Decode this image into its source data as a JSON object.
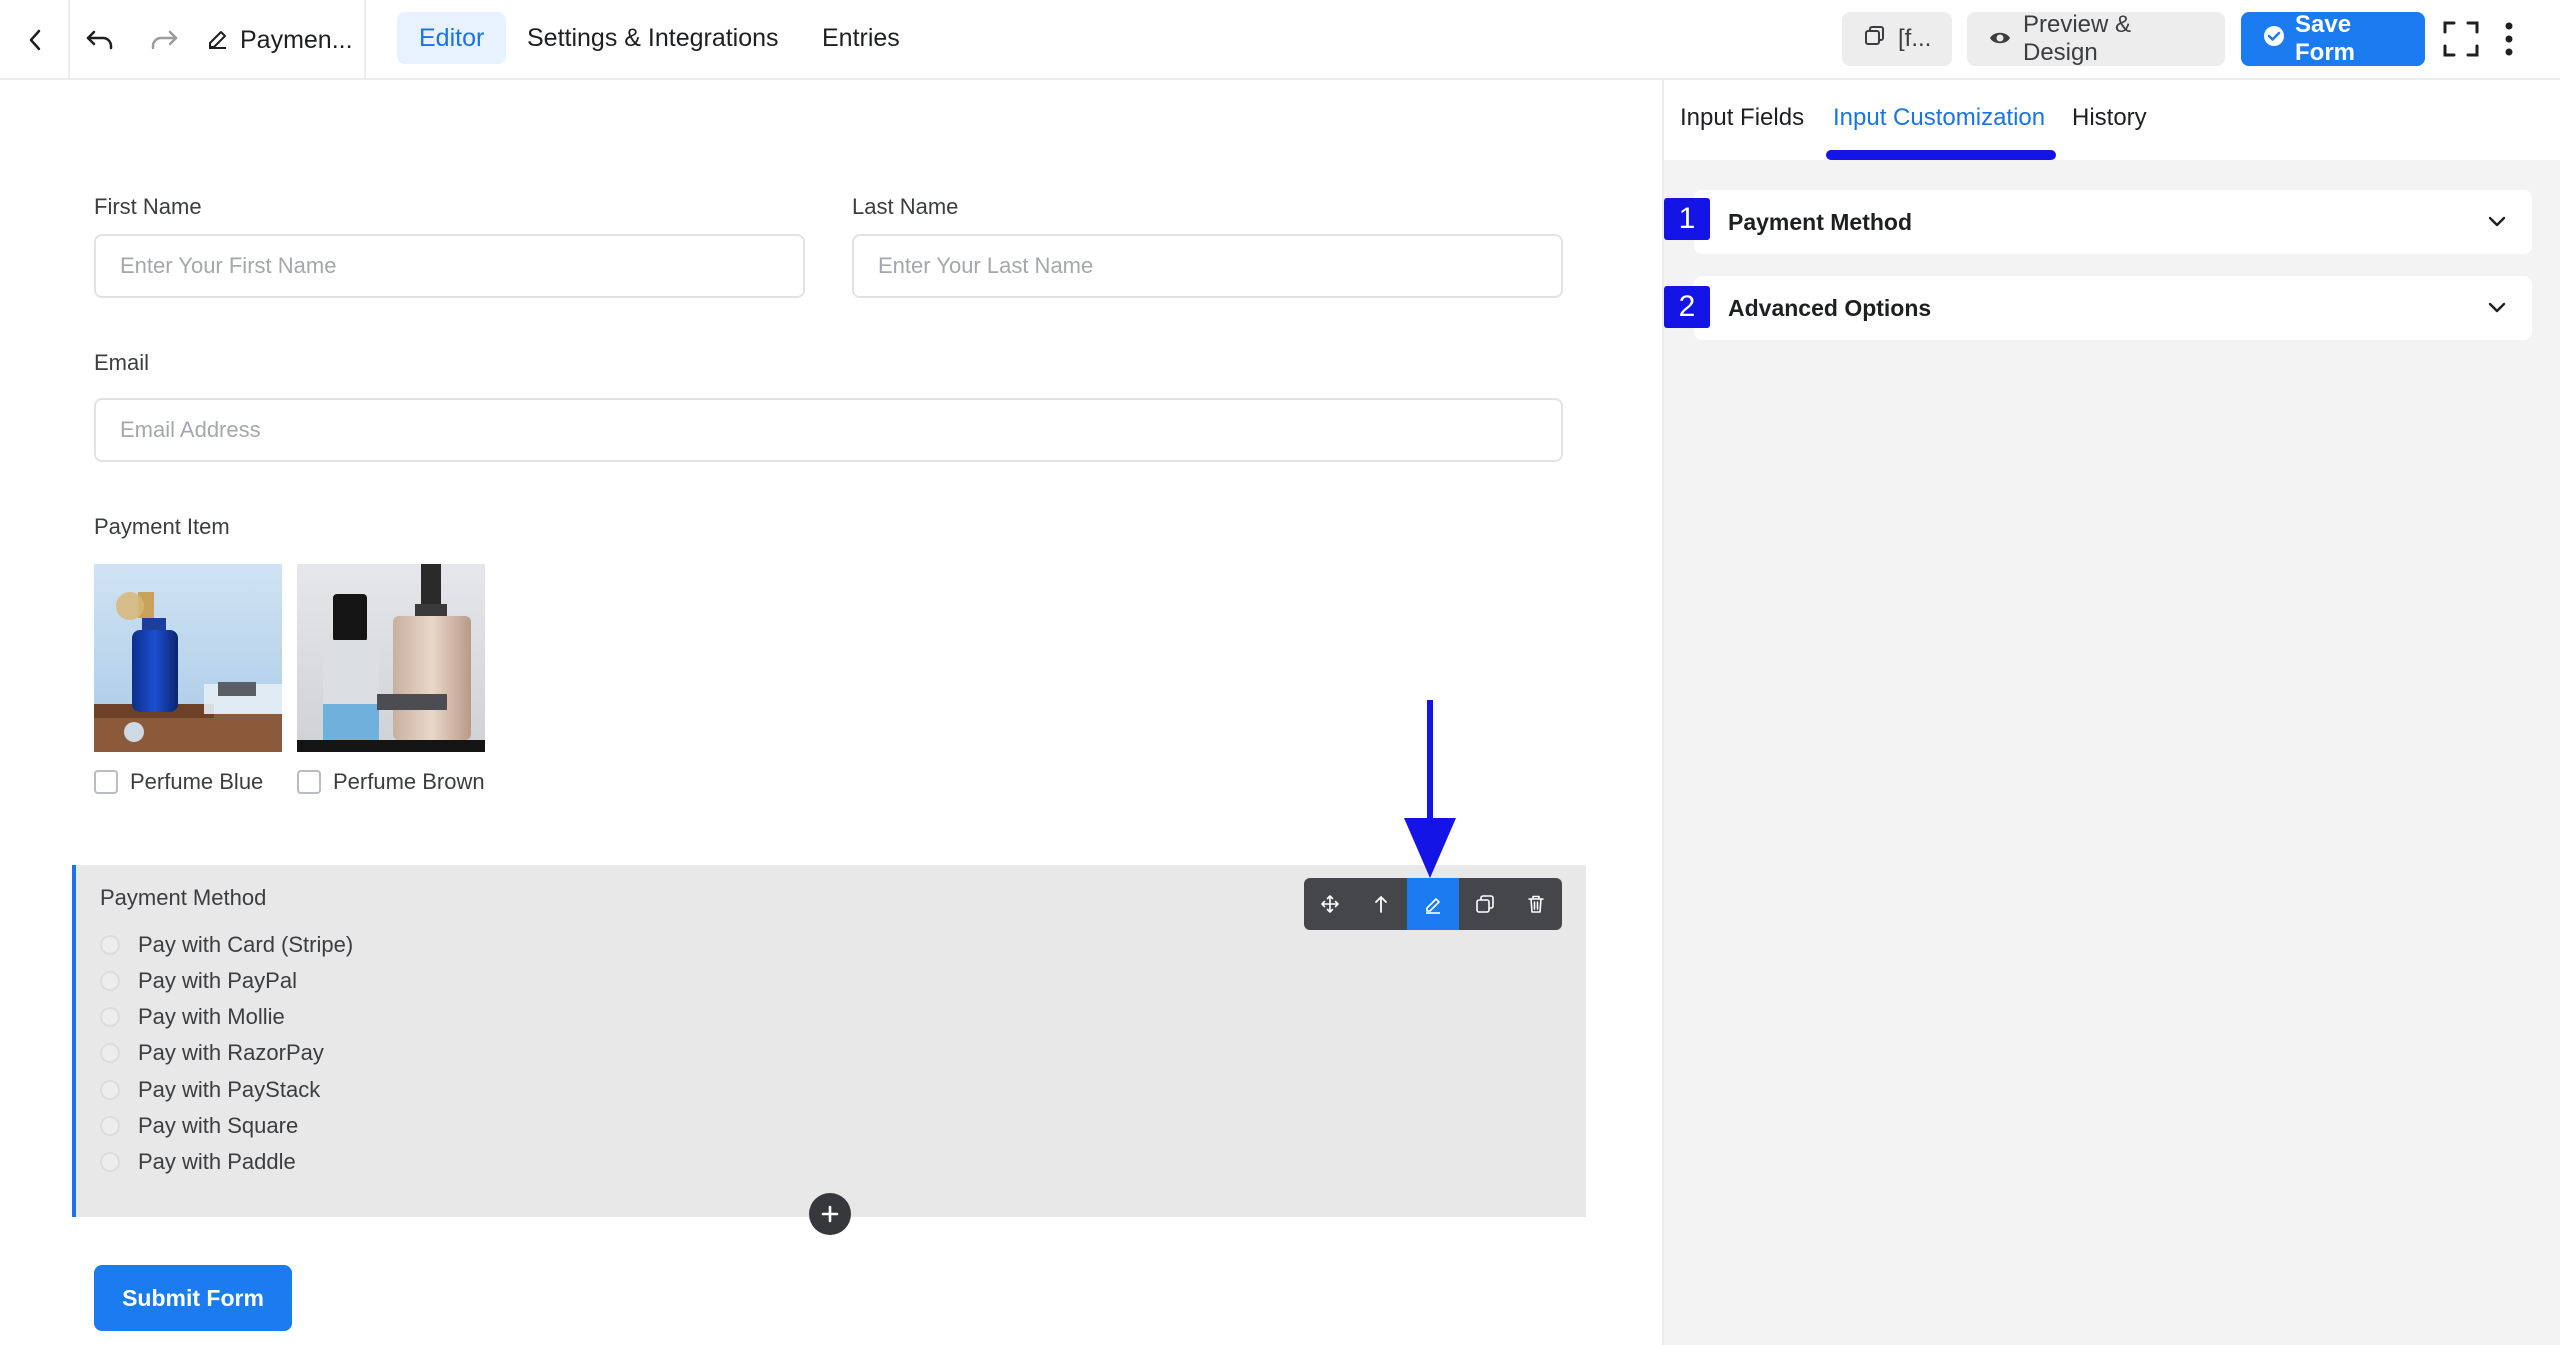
{
  "topbar": {
    "form_title": "Paymen...",
    "tabs": [
      "Editor",
      "Settings & Integrations",
      "Entries"
    ],
    "shortcode_label": "[f...",
    "preview_label": "Preview & Design",
    "save_label": "Save Form"
  },
  "form": {
    "first_name": {
      "label": "First Name",
      "placeholder": "Enter Your First Name"
    },
    "last_name": {
      "label": "Last Name",
      "placeholder": "Enter Your Last Name"
    },
    "email": {
      "label": "Email",
      "placeholder": "Email Address"
    },
    "payment_item": {
      "label": "Payment Item",
      "items": [
        {
          "label": "Perfume Blue",
          "checked": false
        },
        {
          "label": "Perfume Brown",
          "checked": false
        }
      ]
    },
    "payment_method": {
      "label": "Payment Method",
      "options": [
        "Pay with Card (Stripe)",
        "Pay with PayPal",
        "Pay with Mollie",
        "Pay with RazorPay",
        "Pay with PayStack",
        "Pay with Square",
        "Pay with Paddle"
      ]
    },
    "submit_label": "Submit Form"
  },
  "panel": {
    "tabs": [
      "Input Fields",
      "Input Customization",
      "History"
    ],
    "active_tab": "Input Customization",
    "sections": [
      {
        "badge": "1",
        "title": "Payment Method"
      },
      {
        "badge": "2",
        "title": "Advanced Options"
      }
    ]
  },
  "colors": {
    "accent": "#1a7cf0",
    "annotation": "#1414e6"
  }
}
